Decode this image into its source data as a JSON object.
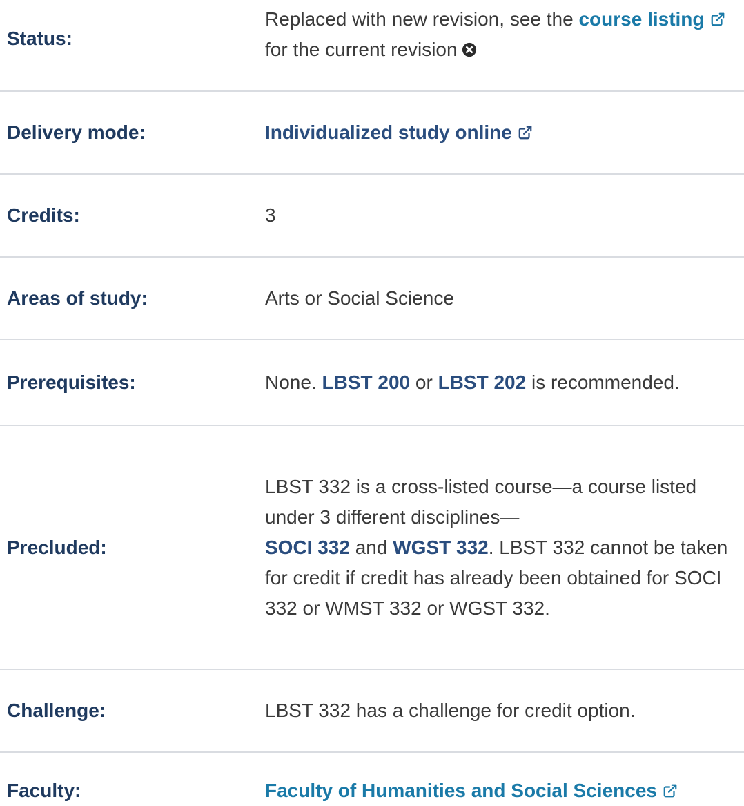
{
  "rows": {
    "status": {
      "label": "Status:",
      "text_before": "Replaced with new revision, see the ",
      "link": "course listing",
      "text_after": " for the current revision"
    },
    "delivery": {
      "label": "Delivery mode:",
      "link": "Individualized study online"
    },
    "credits": {
      "label": "Credits:",
      "value": "3"
    },
    "areas": {
      "label": "Areas of study:",
      "value": "Arts or Social Science"
    },
    "prerequisites": {
      "label": "Prerequisites:",
      "text_1": "None. ",
      "link_1": "LBST 200",
      "text_2": " or ",
      "link_2": "LBST 202",
      "text_3": " is recommended."
    },
    "precluded": {
      "label": "Precluded:",
      "text_1": "LBST 332 is a cross-listed course—a course listed under 3 different disciplines—",
      "link_1": "SOCI 332",
      "text_2": " and ",
      "link_2": "WGST 332",
      "text_3": ". LBST 332 cannot be taken for credit if credit has already been obtained for SOCI 332 or WMST 332 or WGST 332."
    },
    "challenge": {
      "label": "Challenge:",
      "value": "LBST 332 has a challenge for credit option."
    },
    "faculty": {
      "label": "Faculty:",
      "link": "Faculty of Humanities and Social Sciences"
    }
  },
  "icons": {
    "external_link": "external-link-icon",
    "close_circle": "close-circle-icon"
  },
  "colors": {
    "label": "#1f3a5f",
    "link": "#2a4d7e",
    "link_teal": "#1a7aa8",
    "divider": "#d9dce1",
    "text": "#3a3a3a"
  }
}
